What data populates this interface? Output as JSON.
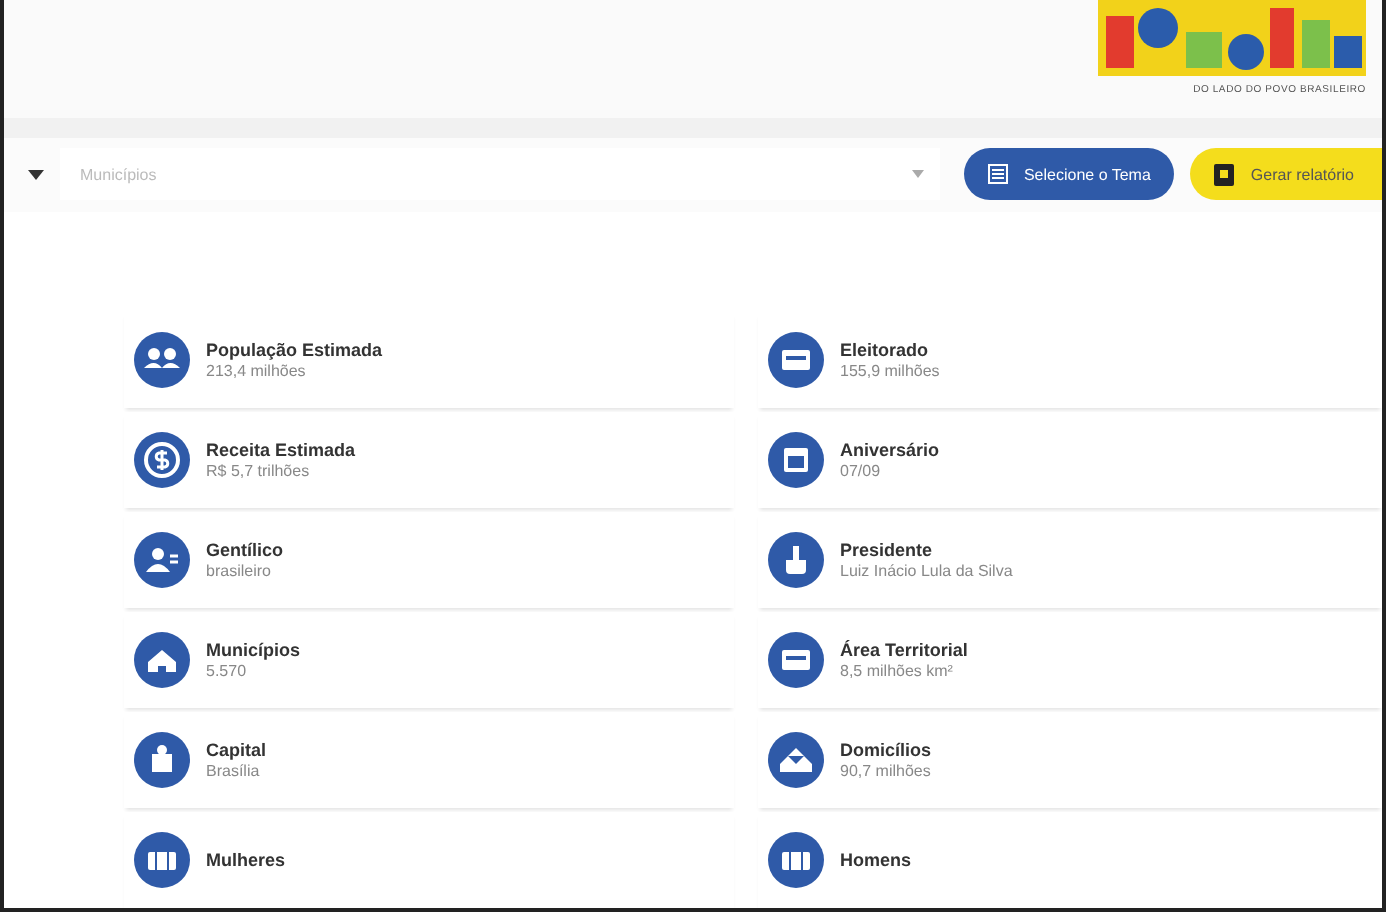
{
  "header": {
    "tagline": "DO LADO DO POVO BRASILEIRO"
  },
  "toolbar": {
    "municipio_placeholder": "Municípios",
    "theme_button": "Selecione o Tema",
    "report_button": "Gerar relatório"
  },
  "stats": [
    {
      "label": "População Estimada",
      "value": "213,4 milhões"
    },
    {
      "label": "Eleitorado",
      "value": "155,9 milhões"
    },
    {
      "label": "Receita Estimada",
      "value": "R$ 5,7 trilhões"
    },
    {
      "label": "Aniversário",
      "value": "07/09"
    },
    {
      "label": "Gentílico",
      "value": "brasileiro"
    },
    {
      "label": "Presidente",
      "value": "Luiz Inácio Lula da Silva"
    },
    {
      "label": "Municípios",
      "value": "5.570"
    },
    {
      "label": "Área Territorial",
      "value": "8,5 milhões km²"
    },
    {
      "label": "Capital",
      "value": "Brasília"
    },
    {
      "label": "Domicílios",
      "value": "90,7 milhões"
    },
    {
      "label": "Mulheres"
    },
    {
      "label": "Homens"
    }
  ]
}
